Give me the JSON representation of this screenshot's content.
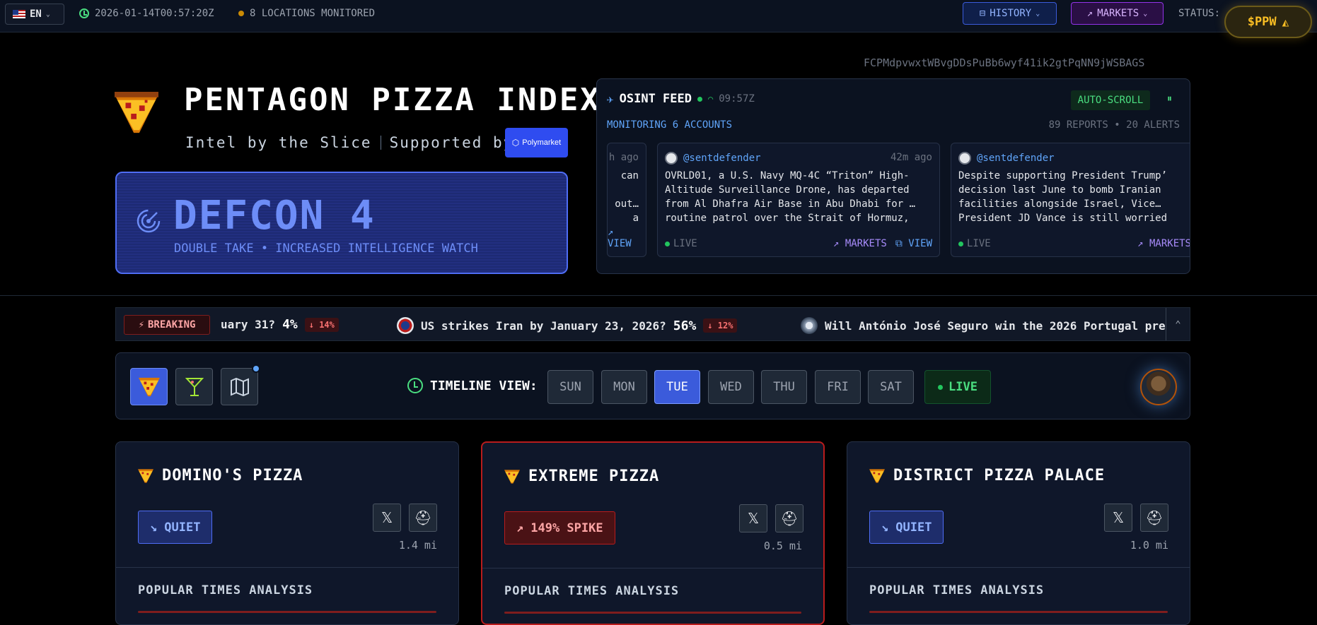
{
  "topbar": {
    "language": "EN",
    "timestamp": "2026-01-14T00:57:20Z",
    "locations": "8 LOCATIONS MONITORED",
    "history_label": "HISTORY",
    "markets_label": "MARKETS",
    "status_label": "STATUS:",
    "token_label": "$PPW"
  },
  "header": {
    "wallet": "FCPMdpvwxtWBvgDDsPuBb6wyf41ik2gtPqNN9jWSBAGS",
    "title": "PENTAGON PIZZA INDEX",
    "tagline": "Intel by the Slice",
    "supported_by": "Supported by",
    "sponsor": "Polymarket"
  },
  "defcon": {
    "level": "DEFCON 4",
    "description": "DOUBLE TAKE • INCREASED INTELLIGENCE WATCH"
  },
  "feed": {
    "title": "OSINT FEED",
    "time": "09:57Z",
    "autoscroll": "AUTO-SCROLL",
    "pause_icon": "⏸",
    "monitoring": "MONITORING 6 ACCOUNTS",
    "reports": "89 REPORTS • 20 ALERTS",
    "partial_card": {
      "ago": "h ago",
      "line1": "can",
      "line2": "",
      "line3": "out…",
      "line4": "a",
      "view": "VIEW"
    },
    "cards": [
      {
        "user": "@sentdefender",
        "ago": "42m ago",
        "text": "OVRLD01, a U.S. Navy MQ-4C “Triton” High-Altitude Surveillance Drone, has departed from Al Dhafra Air Base in Abu Dhabi for … routine patrol over the Strait of Hormuz,",
        "live": "LIVE",
        "markets": "MARKETS",
        "view": "VIEW"
      },
      {
        "user": "@sentdefender",
        "ago": "",
        "text": "Despite supporting President Trump’ decision last June to bomb Iranian facilities alongside Israel, Vice… President JD Vance is still worried",
        "live": "LIVE",
        "markets": "MARKETS",
        "view": ""
      }
    ]
  },
  "ticker": {
    "breaking": "BREAKING",
    "items": [
      {
        "q": "uary 31?",
        "pct": "4%",
        "chg": "14%"
      },
      {
        "q": "US strikes Iran by January 23, 2026?",
        "pct": "56%",
        "chg": "12%"
      },
      {
        "q": "Will António José Seguro win the 2026 Portugal pre",
        "pct": "",
        "chg": ""
      }
    ]
  },
  "timeline": {
    "label": "TIMELINE VIEW:",
    "days": [
      "SUN",
      "MON",
      "TUE",
      "WED",
      "THU",
      "FRI",
      "SAT"
    ],
    "active_day": "TUE",
    "live": "LIVE"
  },
  "locations": [
    {
      "name": "DOMINO'S PIZZA",
      "status": "QUIET",
      "distance": "1.4 mi",
      "section": "POPULAR TIMES ANALYSIS"
    },
    {
      "name": "EXTREME PIZZA",
      "status": "149% SPIKE",
      "distance": "0.5 mi",
      "section": "POPULAR TIMES ANALYSIS"
    },
    {
      "name": "DISTRICT PIZZA PALACE",
      "status": "QUIET",
      "distance": "1.0 mi",
      "section": "POPULAR TIMES ANALYSIS"
    }
  ],
  "colors": {
    "accent": "#3b5bdb",
    "spike": "#b91c1c",
    "live": "#4ade80",
    "markets": "#a78bfa"
  }
}
